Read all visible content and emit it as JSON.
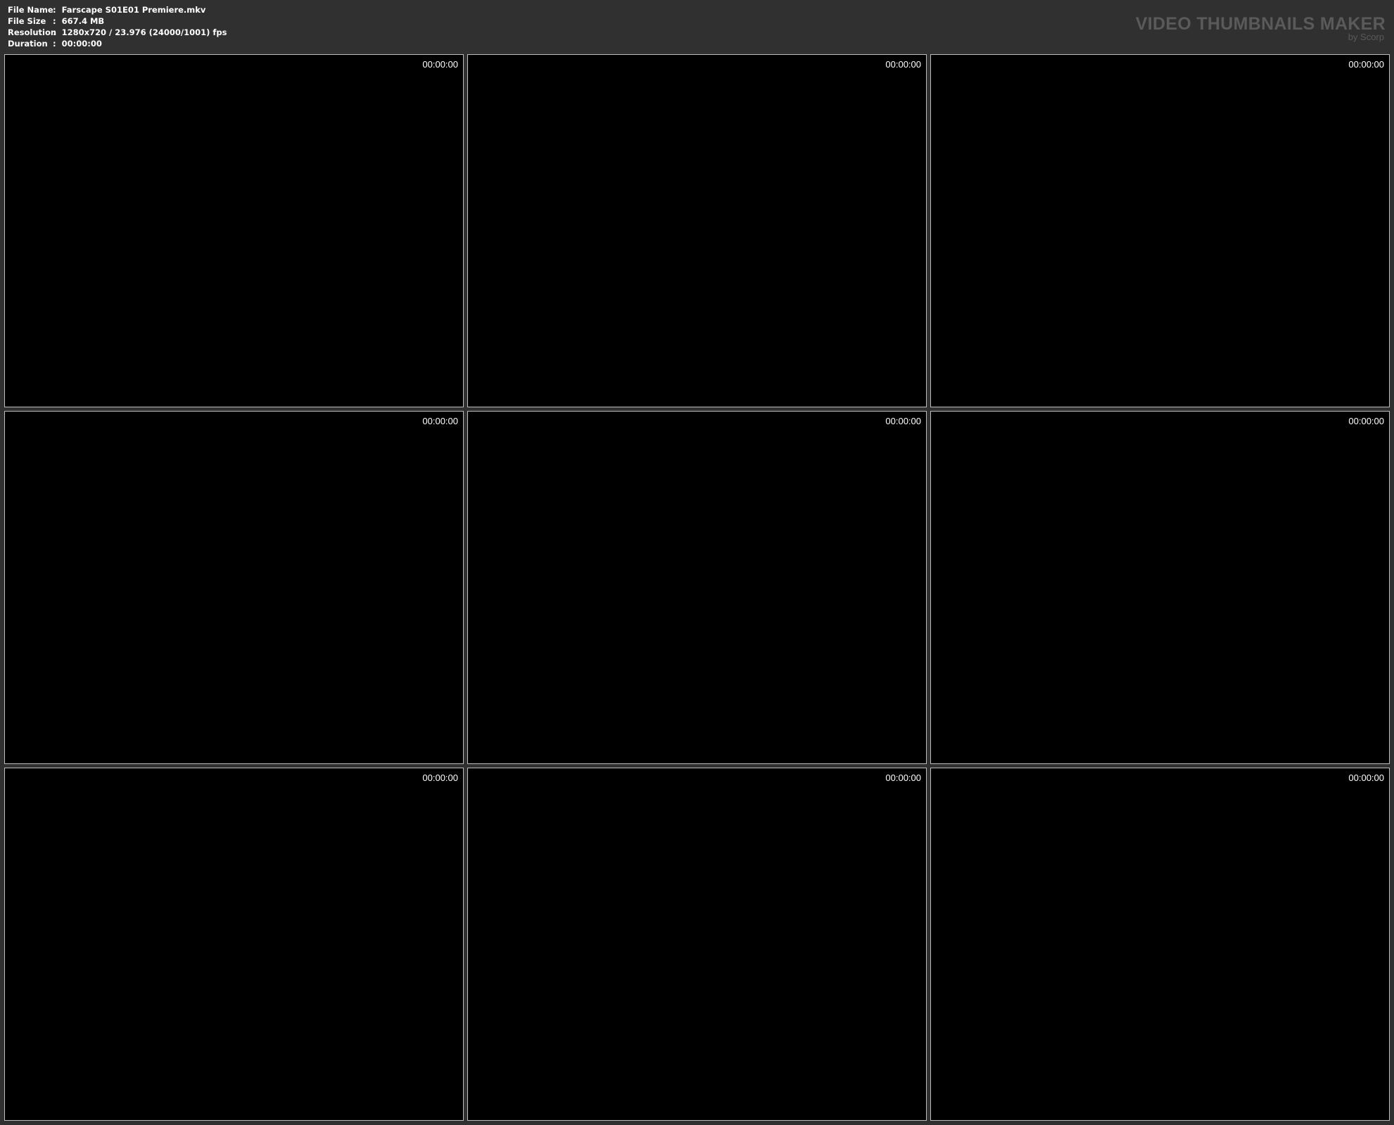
{
  "info": {
    "rows": [
      {
        "label": "File Name",
        "sep": ":",
        "value": "Farscape S01E01 Premiere.mkv"
      },
      {
        "label": "File Size",
        "sep": ":",
        "value": "667.4 MB"
      },
      {
        "label": "Resolution",
        "sep": ":",
        "value": "1280x720 / 23.976 (24000/1001) fps"
      },
      {
        "label": "Duration",
        "sep": ":",
        "value": "00:00:00"
      }
    ]
  },
  "brand": {
    "title": "VIDEO THUMBNAILS MAKER",
    "by": "by Scorp"
  },
  "thumbnails": [
    {
      "timestamp": "00:00:00"
    },
    {
      "timestamp": "00:00:00"
    },
    {
      "timestamp": "00:00:00"
    },
    {
      "timestamp": "00:00:00"
    },
    {
      "timestamp": "00:00:00"
    },
    {
      "timestamp": "00:00:00"
    },
    {
      "timestamp": "00:00:00"
    },
    {
      "timestamp": "00:00:00"
    },
    {
      "timestamp": "00:00:00"
    }
  ],
  "colors": {
    "background": "#303030",
    "thumbnail": "#000000",
    "border": "#bdbdbd",
    "brand_text": "#5a5a5a"
  }
}
